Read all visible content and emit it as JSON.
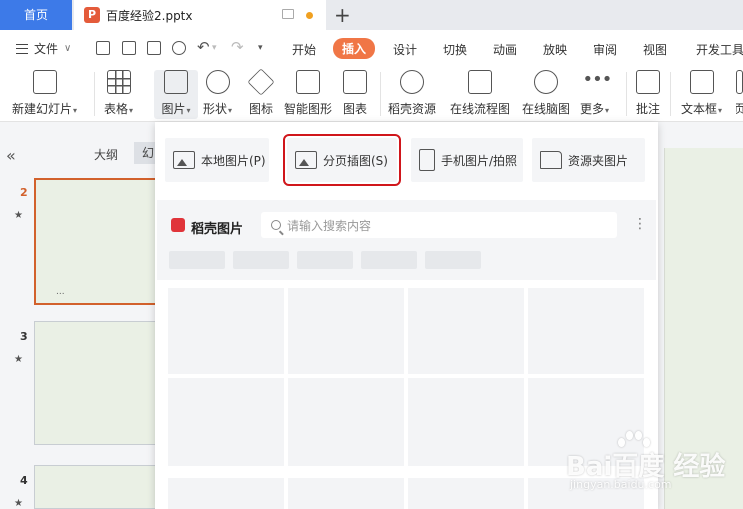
{
  "tabs": {
    "home": "首页",
    "doc_badge": "P",
    "doc": "百度经验2.pptx",
    "plus": "+"
  },
  "menubar": {
    "file": "文件",
    "tabs": [
      "开始",
      "插入",
      "设计",
      "切换",
      "动画",
      "放映",
      "审阅",
      "视图",
      "开发工具"
    ],
    "active_tab": "插入"
  },
  "ribbon": {
    "new_slide": "新建幻灯片",
    "table": "表格",
    "picture": "图片",
    "shape": "形状",
    "icon": "图标",
    "smart_shape": "智能图形",
    "chart": "图表",
    "docer_resource": "稻壳资源",
    "online_flowchart": "在线流程图",
    "online_mindmap": "在线脑图",
    "more": "更多",
    "comment": "批注",
    "textbox": "文本框",
    "cut_off": "页"
  },
  "left_panel": {
    "collapse": "«",
    "outline": "大纲",
    "slides": "幻灯片",
    "slide_numbers": [
      "2",
      "3",
      "4"
    ],
    "ellipsis": "..."
  },
  "picture_menu": {
    "local": "本地图片(P)",
    "split_insert": "分页插图(S)",
    "phone": "手机图片/拍照",
    "resource_folder": "资源夹图片",
    "stock_title": "稻壳图片",
    "search_placeholder": "请输入搜索内容"
  },
  "watermark": {
    "logo": "Bai百度 经验",
    "url": "jingyan.baidu.com"
  },
  "colors": {
    "accent_blue": "#3d7ae8",
    "insert_tab": "#f07646",
    "highlight_box": "#d0161b",
    "selected_slide": "#d2612c"
  }
}
